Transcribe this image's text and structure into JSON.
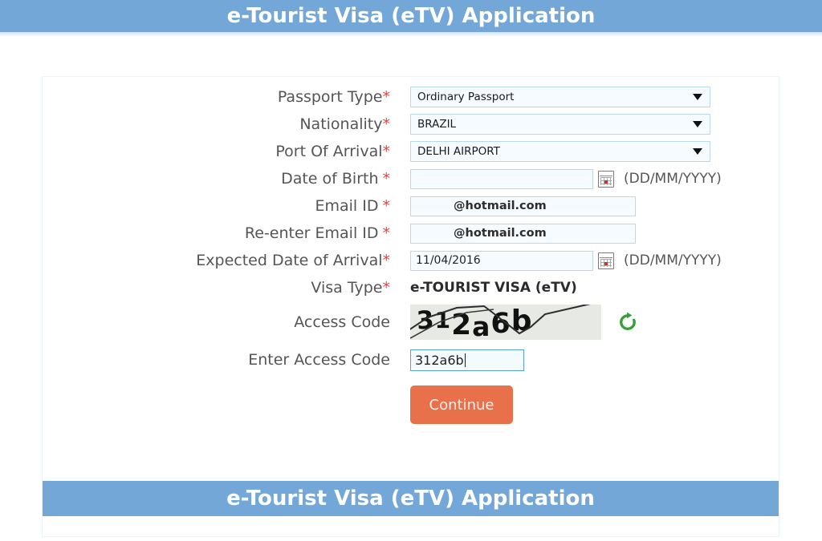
{
  "header": {
    "title": "e-Tourist Visa (eTV) Application"
  },
  "footer_header": {
    "title": "e-Tourist Visa (eTV) Application"
  },
  "form": {
    "rows": [
      {
        "label": "Passport Type",
        "required_mark": "*",
        "value": "Ordinary Passport",
        "type": "select"
      },
      {
        "label": "Nationality",
        "required_mark": "*",
        "value": "BRAZIL",
        "type": "select"
      },
      {
        "label": "Port Of Arrival",
        "required_mark": "*",
        "value": "DELHI AIRPORT",
        "type": "select"
      },
      {
        "label": "Date of Birth",
        "required_mark": "*",
        "value": "",
        "hint": "(DD/MM/YYYY)",
        "type": "date"
      },
      {
        "label": "Email ID",
        "required_mark": "*",
        "value": "@hotmail.com",
        "type": "email"
      },
      {
        "label": "Re-enter Email ID",
        "required_mark": "*",
        "value": "@hotmail.com",
        "type": "email"
      },
      {
        "label": "Expected Date of Arrival",
        "required_mark": "*",
        "value": "11/04/2016",
        "hint": "(DD/MM/YYYY)",
        "type": "date"
      },
      {
        "label": "Visa Type",
        "required_mark": "*",
        "value": "e-TOURIST VISA (eTV)",
        "type": "static"
      }
    ],
    "access_code": {
      "label": "Access Code",
      "captcha_text": "312a6b",
      "refresh_icon": "refresh-icon"
    },
    "enter_access_code": {
      "label": "Enter Access Code",
      "value": "312a6b"
    },
    "continue_button": {
      "label": "Continue"
    }
  },
  "icons": {
    "calendar": "calendar-icon",
    "dropdown_caret": "chevron-down-icon"
  },
  "colors": {
    "banner_blue": "#73a7d8",
    "button_orange": "#e8714c",
    "required_red": "#e8403a",
    "refresh_green": "#35a035",
    "input_border": "#b9d9ef",
    "focus_border": "#5aa0dd"
  }
}
